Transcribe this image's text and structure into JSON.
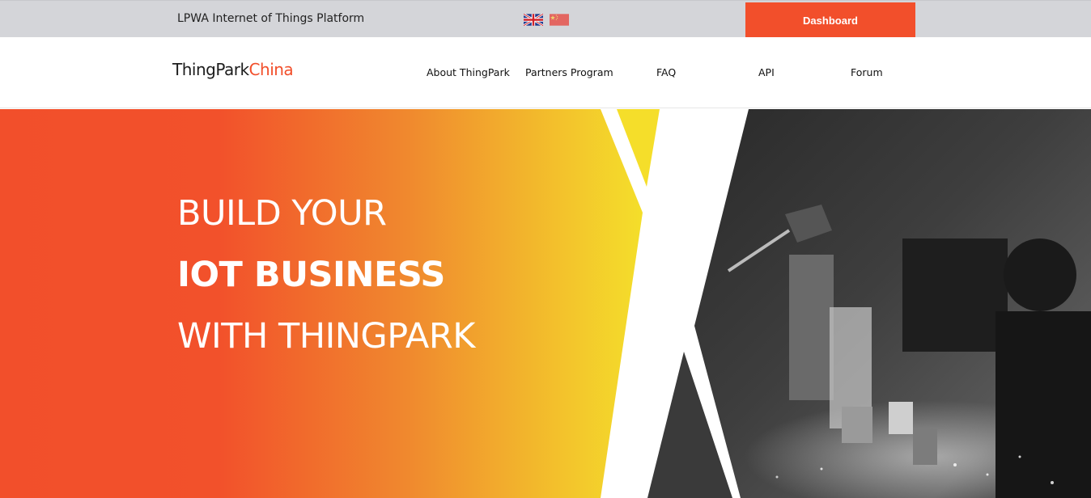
{
  "topbar": {
    "tagline": "LPWA Internet of Things Platform",
    "languages": [
      {
        "icon": "uk-flag-icon"
      },
      {
        "icon": "china-flag-icon"
      }
    ],
    "dashboard_label": "Dashboard"
  },
  "nav": {
    "logo_primary": "ThingPark",
    "logo_accent": "China",
    "items": [
      {
        "label": "About ThingPark"
      },
      {
        "label": "Partners Program"
      },
      {
        "label": "FAQ"
      },
      {
        "label": "API"
      },
      {
        "label": "Forum"
      }
    ]
  },
  "hero": {
    "line1": "BUILD YOUR",
    "line2": "IOT BUSINESS",
    "line3": "WITH THINGPARK"
  },
  "colors": {
    "brand": "#f24f2b",
    "gradient_end": "#f4e62a",
    "topbar_bg": "#d4d5d9"
  }
}
